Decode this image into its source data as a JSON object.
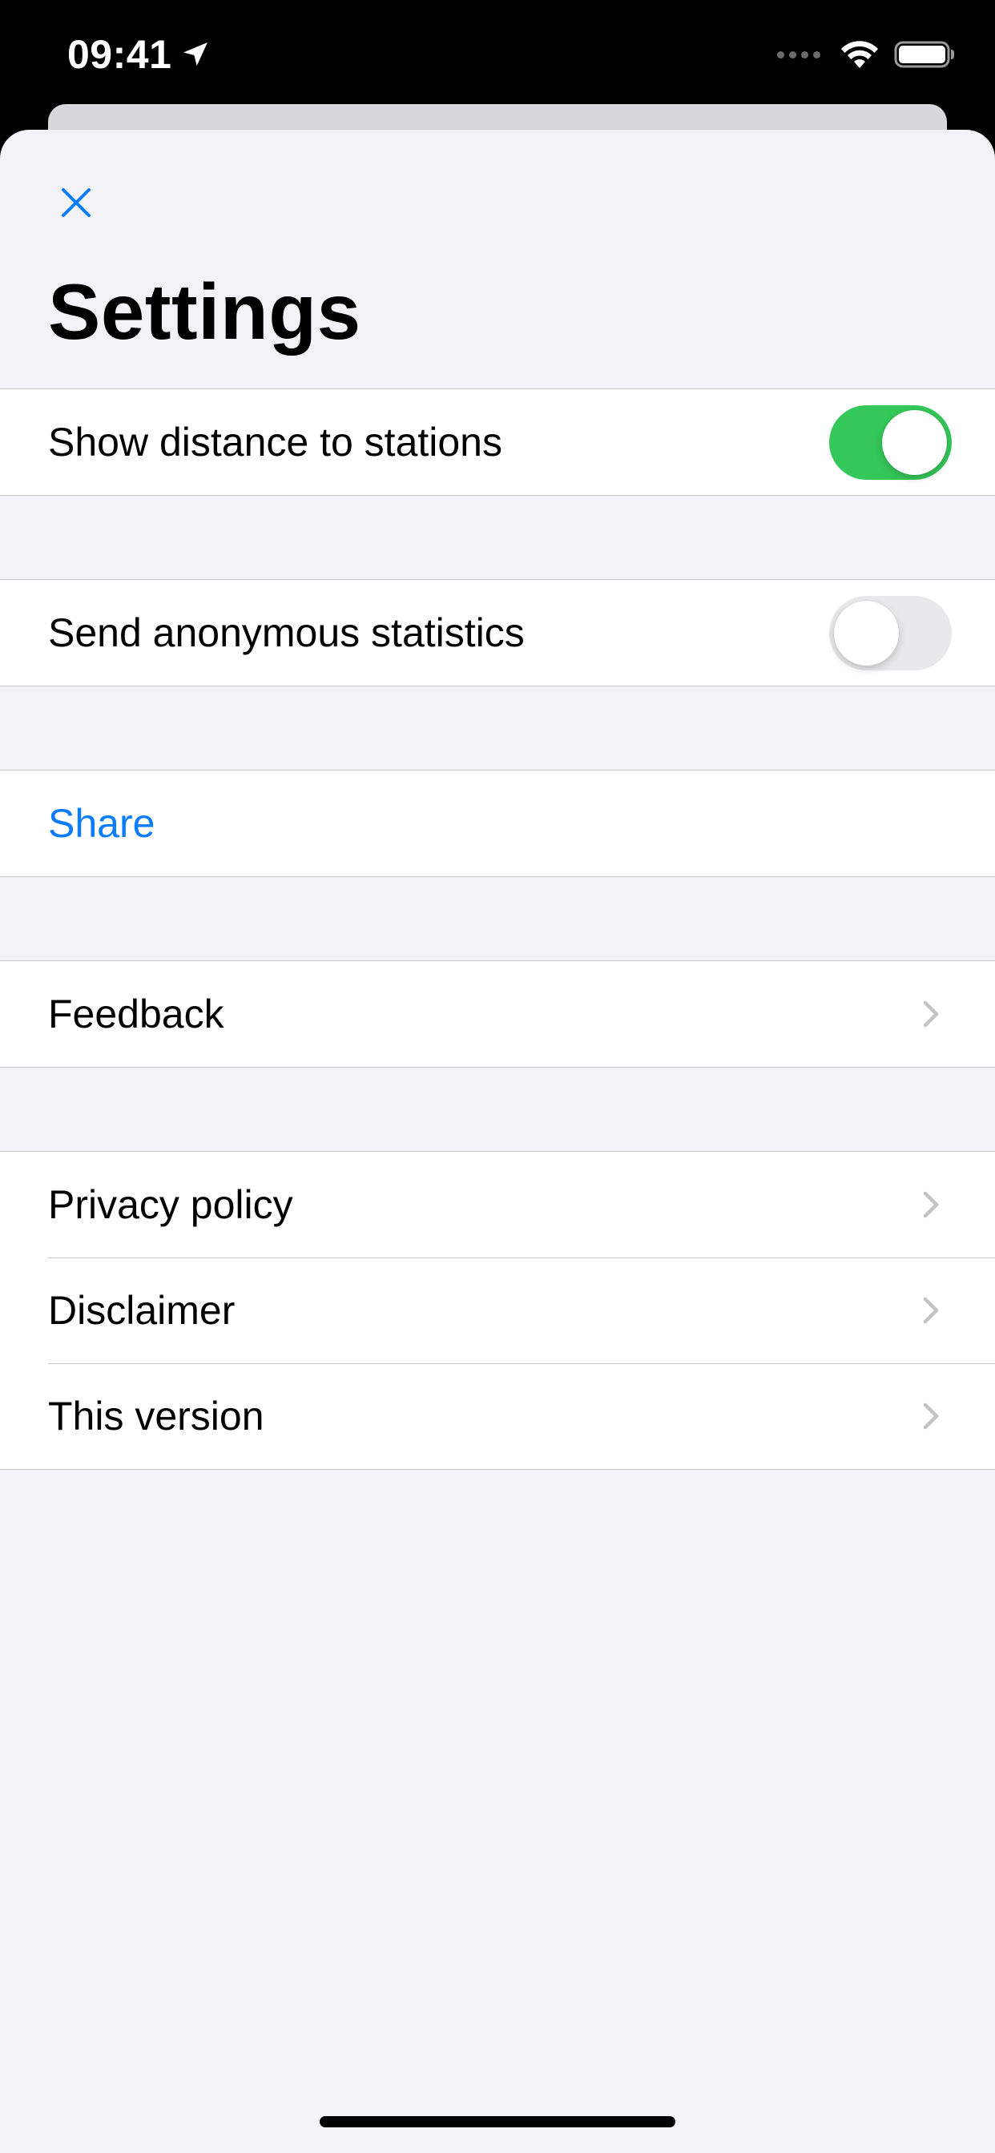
{
  "status_bar": {
    "time": "09:41",
    "location_icon": "location-arrow-icon",
    "signal_icon": "cellular-signal-icon",
    "wifi_icon": "wifi-icon",
    "battery_icon": "battery-icon"
  },
  "header": {
    "close_icon": "close-icon",
    "title": "Settings"
  },
  "groups": [
    {
      "rows": [
        {
          "label": "Show distance to stations",
          "control": "toggle",
          "on": true
        }
      ]
    },
    {
      "rows": [
        {
          "label": "Send anonymous statistics",
          "control": "toggle",
          "on": false
        }
      ]
    },
    {
      "rows": [
        {
          "label": "Share",
          "control": "link"
        }
      ]
    },
    {
      "rows": [
        {
          "label": "Feedback",
          "control": "chevron"
        }
      ]
    },
    {
      "rows": [
        {
          "label": "Privacy policy",
          "control": "chevron"
        },
        {
          "label": "Disclaimer",
          "control": "chevron"
        },
        {
          "label": "This version",
          "control": "chevron"
        }
      ]
    }
  ],
  "colors": {
    "accent": "#0a7cff",
    "toggle_on": "#34c759",
    "toggle_off": "#e9e9eb",
    "background": "#f2f2f7",
    "separator": "#c6c6c8"
  }
}
